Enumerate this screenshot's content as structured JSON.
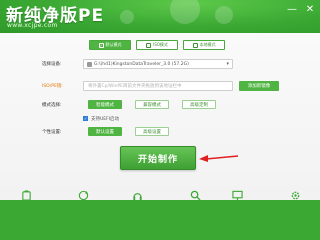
{
  "app": {
    "title": "新纯净版PE",
    "url": "www.xcjpe.com"
  },
  "window": {
    "minimize_icon": "minimize-icon",
    "close_icon": "close-icon"
  },
  "tabs": [
    {
      "label": "默认模式",
      "active": true
    },
    {
      "label": "ISO模式",
      "active": false
    },
    {
      "label": "本地模式",
      "active": false
    }
  ],
  "disk": {
    "label": "选择设备:",
    "value": "G:\\(hd1)KingstonDataTraveler_3.0 (57.2G)"
  },
  "pe": {
    "label": "ISO/PE镜:",
    "placeholder": "将外置Cp/WinPE目前文件夹拖放到该地址栏中",
    "add_button": "添加新镜像"
  },
  "mode": {
    "label": "模式选择:",
    "options": [
      {
        "label": "智能模式",
        "active": true
      },
      {
        "label": "兼容模式",
        "active": false
      },
      {
        "label": "高级定制",
        "active": false
      }
    ],
    "uefi_label": "支持UEFI启动",
    "uefi_checked": true
  },
  "personal": {
    "label": "个性设置:",
    "options": [
      {
        "label": "默认设置",
        "active": true
      },
      {
        "label": "高级设置",
        "active": false
      }
    ]
  },
  "start_button": "开始制作",
  "colors": {
    "brand": "#3aa833",
    "accent": "#4fb441",
    "arrow": "#e0201e"
  },
  "bottom_icons": [
    "usb-icon",
    "refresh-icon",
    "headset-icon",
    "search-icon",
    "monitor-icon",
    "gear-icon"
  ]
}
